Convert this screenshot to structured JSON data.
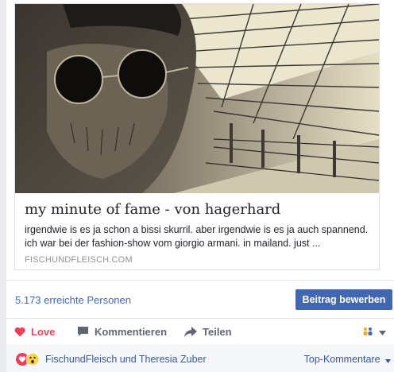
{
  "preview": {
    "title": "my minute of fame - von hagerhard",
    "description": "irgendwie is es ja schon a bissi skurril. aber irgendwie is es ja auch spannend. ich war bei der fashion-show vom giorgio armani. in mailand. just ...",
    "domain": "FISCHUNDFLEISCH.COM"
  },
  "reach": {
    "text": "5.173 erreichte Personen",
    "boost_label": "Beitrag bewerben"
  },
  "actions": {
    "love": "Love",
    "comment": "Kommentieren",
    "share": "Teilen"
  },
  "reactions": {
    "names": "FischundFleisch und Theresia Zuber",
    "top_comments": "Top-Kommentare"
  },
  "colors": {
    "primary": "#4267b2",
    "link": "#385898",
    "love": "#f33e58"
  }
}
